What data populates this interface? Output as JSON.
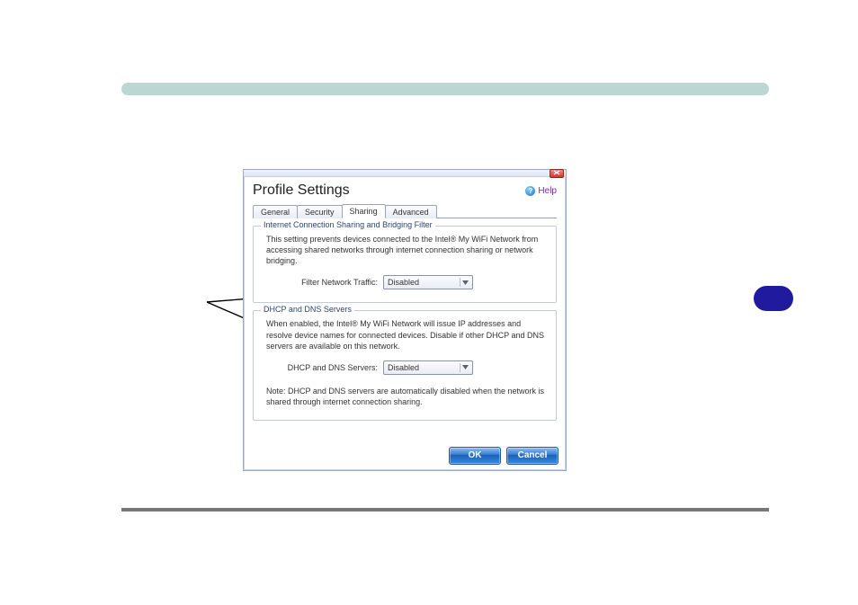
{
  "dialog": {
    "title": "Profile Settings",
    "help_label": "Help",
    "tabs": {
      "general": "General",
      "security": "Security",
      "sharing": "Sharing",
      "advanced": "Advanced"
    },
    "group1": {
      "title": "Internet Connection Sharing and Bridging Filter",
      "desc": "This setting prevents devices connected to the Intel® My WiFi Network from accessing shared networks through internet connection sharing or network bridging.",
      "field_label": "Filter Network Traffic:",
      "field_value": "Disabled"
    },
    "group2": {
      "title": "DHCP and DNS Servers",
      "desc": "When enabled, the Intel® My WiFi Network will issue IP addresses and resolve device names for connected devices.  Disable if other DHCP and DNS servers are available on this network.",
      "field_label": "DHCP and DNS Servers:",
      "field_value": "Disabled",
      "note": "Note: DHCP and DNS servers are automatically disabled when the network is shared through internet connection sharing."
    },
    "buttons": {
      "ok": "OK",
      "cancel": "Cancel"
    }
  }
}
